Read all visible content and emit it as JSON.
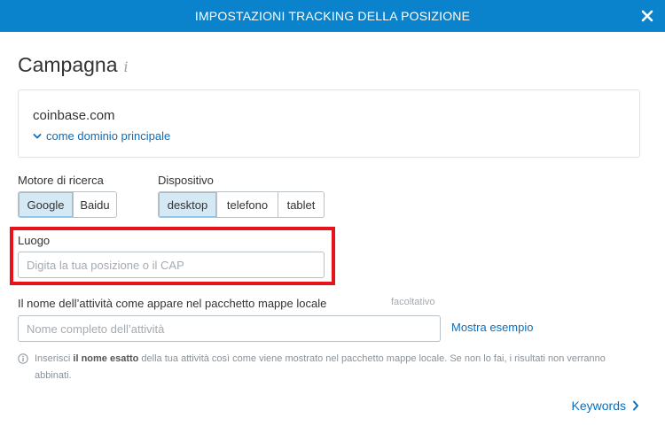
{
  "header": {
    "title": "IMPOSTAZIONI TRACKING DELLA POSIZIONE"
  },
  "campaign": {
    "title": "Campagna",
    "info_icon": "info-icon",
    "domain": "coinbase.com",
    "domain_toggle": "come dominio principale"
  },
  "search_engine": {
    "label": "Motore di ricerca",
    "options": [
      "Google",
      "Baidu"
    ],
    "selected": "Google"
  },
  "device": {
    "label": "Dispositivo",
    "options": [
      "desktop",
      "telefono",
      "tablet"
    ],
    "selected": "desktop"
  },
  "location": {
    "label": "Luogo",
    "placeholder": "Digita la tua posizione o il CAP"
  },
  "business": {
    "label": "Il nome dell’attività come appare nel pacchetto mappe locale",
    "optional": "facoltativo",
    "placeholder": "Nome completo dell’attività",
    "example_link": "Mostra esempio"
  },
  "note": {
    "text_before": "Inserisci ",
    "text_bold": "il nome esatto",
    "text_after": " della tua attività così come viene mostrato nel pacchetto mappe locale. Se non lo fai, i risultati non verranno abbinati."
  },
  "footer": {
    "next_label": "Keywords"
  },
  "colors": {
    "header": "#0a82cc",
    "link": "#0a6ebd",
    "highlight": "#e8121a",
    "active_segment": "#d5e9f5"
  }
}
